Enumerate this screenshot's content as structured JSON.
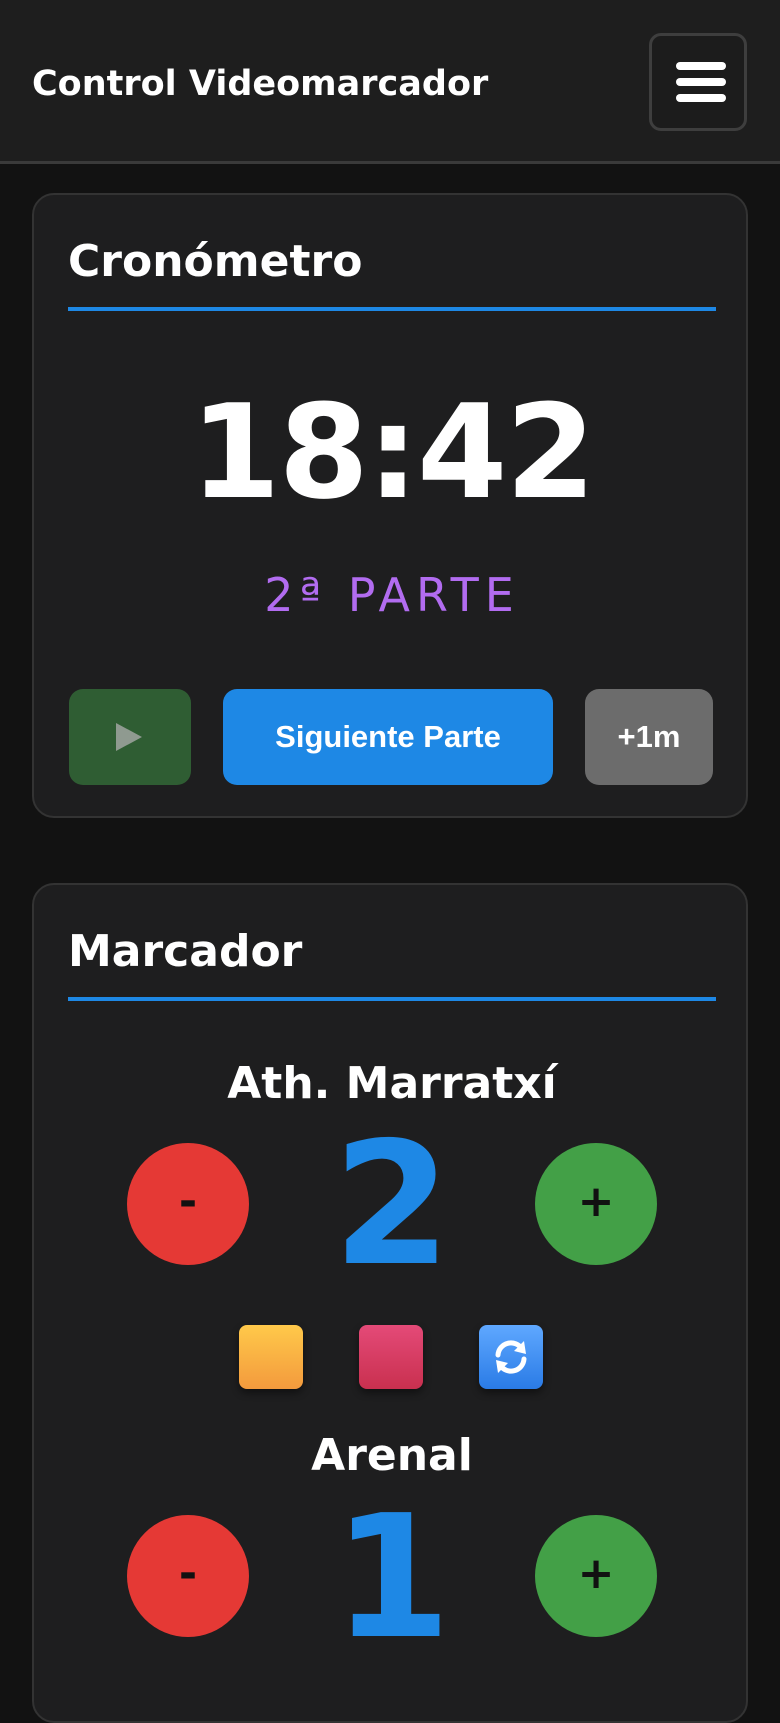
{
  "header": {
    "title": "Control Videomarcador",
    "menu_icon": "hamburger-icon"
  },
  "timer": {
    "title": "Cronómetro",
    "time": "18:42",
    "period": "2ª PARTE",
    "play_icon": "play-icon",
    "next_label": "Siguiente Parte",
    "add_minute_label": "+1m"
  },
  "scoreboard": {
    "title": "Marcador",
    "teams": [
      {
        "name": "Ath. Marratxí",
        "score": "2",
        "minus_label": "-",
        "plus_label": "+"
      },
      {
        "name": "Arenal",
        "score": "1",
        "minus_label": "-",
        "plus_label": "+"
      }
    ],
    "actions": [
      {
        "icon": "yellow-card-icon"
      },
      {
        "icon": "red-card-icon"
      },
      {
        "icon": "substitution-icon"
      }
    ]
  },
  "colors": {
    "accent": "#1e88e5",
    "period": "#b26cf0",
    "minus": "#e53935",
    "plus": "#43a047",
    "play": "#2f5d33"
  }
}
